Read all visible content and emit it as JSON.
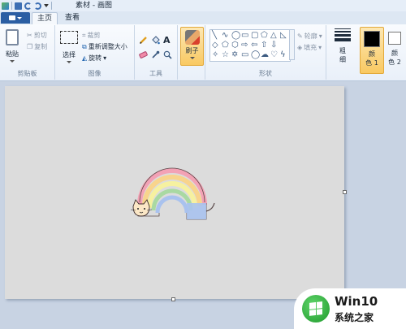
{
  "window": {
    "title": "素材 - 画图"
  },
  "tabs": {
    "file_label": "",
    "home": "主页",
    "view": "查看"
  },
  "clipboard": {
    "paste": "粘贴",
    "cut": "剪切",
    "copy": "复制",
    "group": "剪贴板"
  },
  "image": {
    "select": "选择",
    "crop": "裁剪",
    "resize": "重新调整大小",
    "rotate": "旋转",
    "group": "图像"
  },
  "tools": {
    "group": "工具",
    "items": [
      "pencil-icon",
      "fill-icon",
      "text-icon",
      "eraser-icon",
      "color-picker-icon",
      "magnifier-icon"
    ],
    "text_glyph": "A"
  },
  "brushes": {
    "label": "刷子"
  },
  "shapes": {
    "group": "形状",
    "outline": "轮廓",
    "fill": "填充"
  },
  "size": {
    "label1": "粗",
    "label2": "细"
  },
  "colors": {
    "color1_a": "颜",
    "color1_b": "色 1",
    "color2_a": "颜",
    "color2_b": "色 2",
    "color1_hex": "#000000",
    "color2_hex": "#ffffff"
  },
  "watermark": {
    "line1": "Win10",
    "line2": "系统之家"
  }
}
